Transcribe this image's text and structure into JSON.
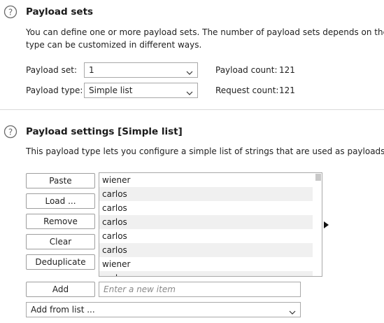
{
  "payload_sets": {
    "title": "Payload sets",
    "description_line1": "You can define one or more payload sets. The number of payload sets depends on the",
    "description_line2": "type can be customized in different ways.",
    "set_label": "Payload set:",
    "set_value": "1",
    "type_label": "Payload type:",
    "type_value": "Simple list",
    "payload_count_label": "Payload count:",
    "payload_count_value": "121",
    "request_count_label": "Request count:",
    "request_count_value": "121"
  },
  "payload_settings": {
    "title": "Payload settings [Simple list]",
    "description": "This payload type lets you configure a simple list of strings that are used as payloads.",
    "buttons": {
      "paste": "Paste",
      "load": "Load ...",
      "remove": "Remove",
      "clear": "Clear",
      "deduplicate": "Deduplicate",
      "add": "Add"
    },
    "list_items": [
      "wiener",
      "carlos",
      "carlos",
      "carlos",
      "carlos",
      "carlos",
      "wiener",
      "carlos"
    ],
    "new_item_placeholder": "Enter a new item",
    "add_from_list_value": "Add from list ..."
  },
  "icons": {
    "help": "help-circle-icon",
    "dropdown": "chevron-down-icon",
    "marker": "triangle-right-icon"
  },
  "colors": {
    "border": "#a9a9a9",
    "alt_row": "#f0f0f0",
    "divider": "#d9d9d9"
  }
}
